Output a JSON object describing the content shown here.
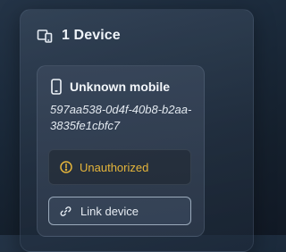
{
  "panel": {
    "title": "1 Device",
    "icon": "devices-icon"
  },
  "device": {
    "icon": "mobile-icon",
    "name": "Unknown mobile",
    "id": "597aa538-0d4f-40b8-b2aa-3835fe1cbfc7",
    "status": {
      "icon": "warning-circle-icon",
      "label": "Unauthorized",
      "color": "#e5b53b"
    },
    "action": {
      "icon": "link-icon",
      "label": "Link device"
    }
  }
}
